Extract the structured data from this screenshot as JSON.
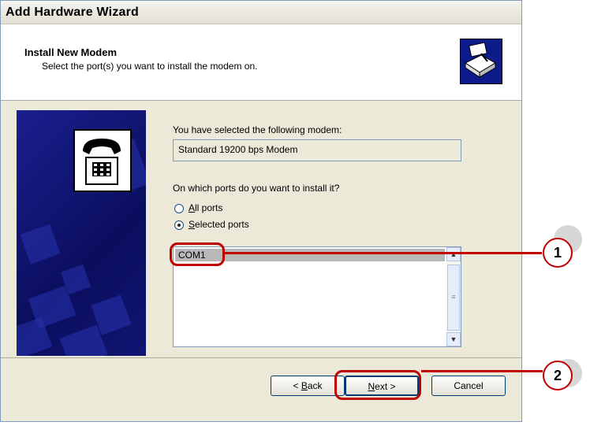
{
  "window": {
    "title": "Add Hardware Wizard"
  },
  "header": {
    "title": "Install New Modem",
    "subtitle": "Select the port(s) you want to install the modem on."
  },
  "content": {
    "selected_label": "You have selected the following modem:",
    "modem_name": "Standard 19200 bps Modem",
    "ports_question": "On which ports do you want to install it?",
    "radio_all": {
      "prefix": "",
      "underline": "A",
      "rest": "ll ports",
      "selected": false
    },
    "radio_selected": {
      "prefix": "",
      "underline": "S",
      "rest": "elected ports",
      "selected": true
    },
    "ports": [
      "COM1"
    ]
  },
  "buttons": {
    "back": {
      "prefix": "< ",
      "underline": "B",
      "rest": "ack"
    },
    "next": {
      "prefix": "",
      "underline": "N",
      "rest": "ext >"
    },
    "cancel": "Cancel"
  },
  "callouts": [
    "1",
    "2"
  ],
  "colors": {
    "callout_red": "#c00000",
    "banner_blue": "#0b0e5e"
  }
}
